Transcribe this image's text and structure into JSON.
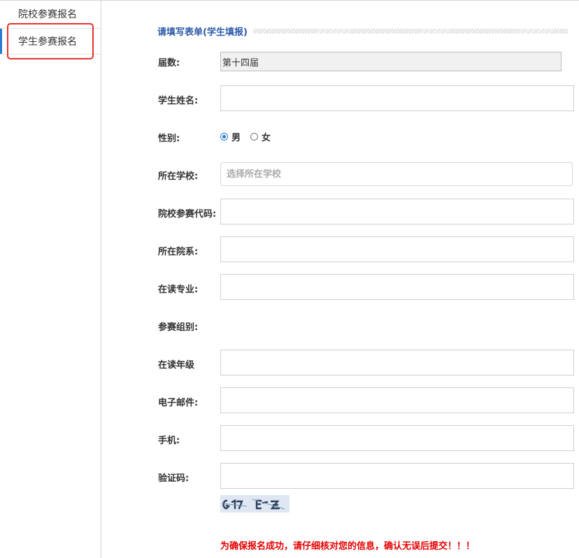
{
  "sidebar": {
    "items": [
      {
        "label": "院校参赛报名"
      },
      {
        "label": "学生参赛报名"
      }
    ]
  },
  "form": {
    "title": "请填写表单(学生填报)",
    "session_label": "届数:",
    "session_value": "第十四届",
    "name_label": "学生姓名:",
    "gender_label": "性别:",
    "gender_male": "男",
    "gender_female": "女",
    "gender_selected": "男",
    "school_label": "所在学校:",
    "school_placeholder": "选择所在学校",
    "code_label": "院校参赛代码:",
    "dept_label": "所在院系:",
    "major_label": "在读专业:",
    "group_label": "参赛组别:",
    "grade_label": "在读年级",
    "email_label": "电子邮件:",
    "phone_label": "手机:",
    "captcha_label": "验证码:",
    "notice": "为确保报名成功，请仔细核对您的信息，确认无误后提交！！！"
  },
  "colors": {
    "accent": "#2a7ad6",
    "title": "#2a5aa8",
    "highlight": "#e8322c",
    "warning": "#e60000"
  }
}
